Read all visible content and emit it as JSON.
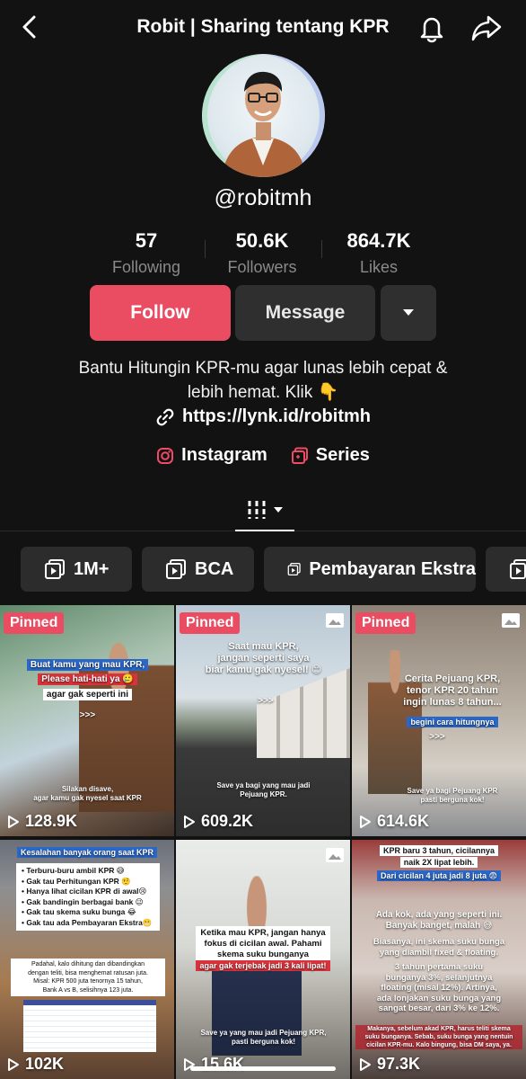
{
  "header": {
    "title": "Robit | Sharing tentang KPR"
  },
  "profile": {
    "username": "@robitmh",
    "stats": [
      {
        "value": "57",
        "label": "Following"
      },
      {
        "value": "50.6K",
        "label": "Followers"
      },
      {
        "value": "864.7K",
        "label": "Likes"
      }
    ],
    "follow_label": "Follow",
    "message_label": "Message",
    "bio_line1": "Bantu Hitungin KPR-mu agar lunas lebih cepat &",
    "bio_line2": "lebih hemat. Klik 👇",
    "link": "https://lynk.id/robitmh",
    "instagram_label": "Instagram",
    "series_label": "Series"
  },
  "playlists": [
    {
      "label": "1M+"
    },
    {
      "label": "BCA"
    },
    {
      "label": "Pembayaran Ekstra"
    }
  ],
  "videos": [
    {
      "pinned": "Pinned",
      "views": "128.9K",
      "cap1": "Buat kamu yang mau KPR,",
      "cap2": "Please hati-hati ya 🥲",
      "cap3": "agar gak seperti ini",
      "cap4": ">>>",
      "cap5": "Silakan disave,",
      "cap6": "agar kamu gak nyesel saat KPR"
    },
    {
      "pinned": "Pinned",
      "views": "609.2K",
      "cap1": "Saat mau KPR,",
      "cap2": "jangan seperti saya",
      "cap3": "biar kamu gak nyesel! 😊",
      "cap4": ">>>",
      "cap5": "Save ya bagi yang mau jadi",
      "cap6": "Pejuang KPR."
    },
    {
      "pinned": "Pinned",
      "views": "614.6K",
      "cap1": "Cerita Pejuang KPR,",
      "cap2": "tenor KPR 20 tahun",
      "cap3": "ingin lunas 8 tahun...",
      "cap4": "begini cara hitungnya",
      "cap5": ">>>",
      "cap6": "Save ya bagi Pejuang KPR",
      "cap7": "pasti berguna kok!"
    },
    {
      "views": "102K",
      "cap1": "Kesalahan banyak orang saat KPR",
      "b1": "• Terburu-buru ambil KPR 😅",
      "b2": "• Gak tau Perhitungan KPR 🤨",
      "b3": "• Hanya lihat cicilan KPR di awal😢",
      "b4": "• Gak bandingin berbagai bank 😉",
      "b5": "• Gak tau skema suku bunga 😂",
      "b6": "• Gak tau ada Pembayaran Ekstra😬",
      "p1": "Padahal, kalo dihitung dan dibandingkan",
      "p2": "dengan teliti, bisa menghemat ratusan juta.",
      "p3": "Misal: KPR 500 juta tenornya 15 tahun,",
      "p4": "Bank A vs B, selisihnya 123 juta."
    },
    {
      "views": "15.6K",
      "cap1": "Ketika mau KPR, jangan hanya",
      "cap2": "fokus di cicilan awal. Pahami",
      "cap3": "skema suku bunganya",
      "cap4": "agar gak terjebak jadi 3 kali lipat!",
      "cap5": "Save ya yang mau jadi Pejuang KPR,",
      "cap6": "pasti berguna kok!"
    },
    {
      "views": "97.3K",
      "cap1": "KPR baru 3 tahun, cicilannya",
      "cap2": "naik 2X lipat lebih.",
      "cap3": "Dari cicilan 4 juta jadi 8 juta 😨",
      "cap4": "Ada kok, ada yang seperti ini.",
      "cap5": "Banyak banget, malah 😅",
      "cap6": "Biasanya, ini skema suku bunga",
      "cap7": "yang diambil fixed & floating.",
      "cap8": "3 tahun pertama suku",
      "cap9": "bunganya 3%, selanjutnya",
      "cap10": "floating (misal 12%). Artinya,",
      "cap11": "ada lonjakan suku bunga yang",
      "cap12": "sangat besar, dari 3% ke 12%.",
      "cap13": "Makanya, sebelum akad KPR, harus teliti skema",
      "cap14": "suku bunganya. Sebab, suku bunga yang nentuin",
      "cap15": "cicilan KPR-mu. Kalo bingung, bisa DM saya, ya."
    }
  ]
}
